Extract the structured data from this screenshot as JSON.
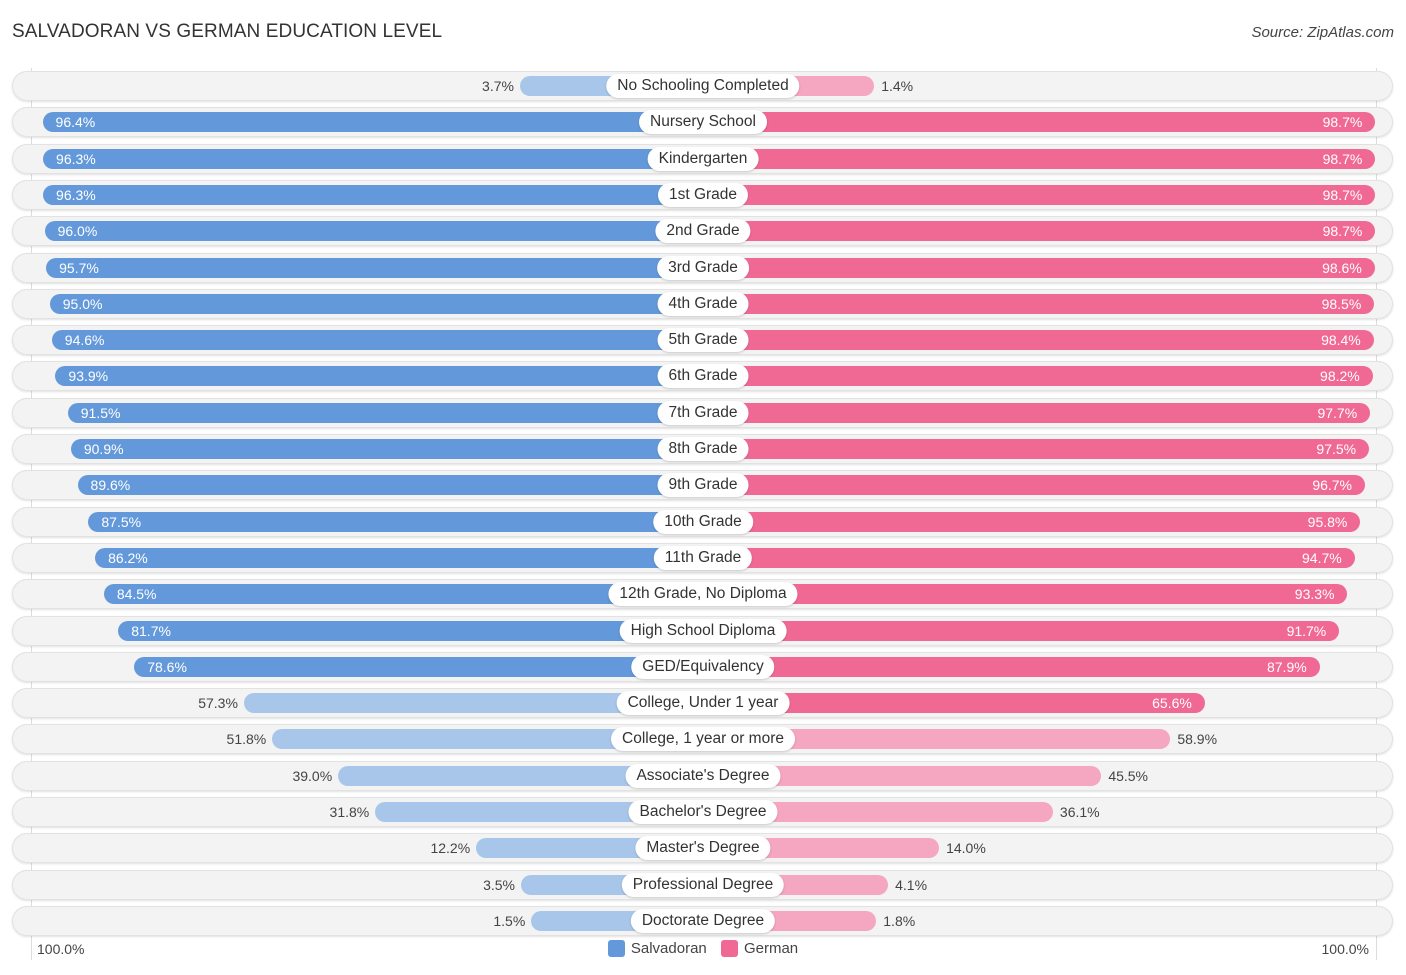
{
  "chart_data": {
    "type": "bar",
    "orientation": "horizontal-diverging",
    "title": "SALVADORAN VS GERMAN EDUCATION LEVEL",
    "source": "Source: ZipAtlas.com",
    "xlabel": "",
    "ylabel": "",
    "axis_left_label": "100.0%",
    "axis_right_label": "100.0%",
    "xlim": [
      0,
      100
    ],
    "legend_position": "bottom-center",
    "categories": [
      "No Schooling Completed",
      "Nursery School",
      "Kindergarten",
      "1st Grade",
      "2nd Grade",
      "3rd Grade",
      "4th Grade",
      "5th Grade",
      "6th Grade",
      "7th Grade",
      "8th Grade",
      "9th Grade",
      "10th Grade",
      "11th Grade",
      "12th Grade, No Diploma",
      "High School Diploma",
      "GED/Equivalency",
      "College, Under 1 year",
      "College, 1 year or more",
      "Associate's Degree",
      "Bachelor's Degree",
      "Master's Degree",
      "Professional Degree",
      "Doctorate Degree"
    ],
    "series": [
      {
        "name": "Salvadoran",
        "color": "#6399da",
        "light_color": "#a8c6ea",
        "values": [
          3.7,
          96.4,
          96.3,
          96.3,
          96.0,
          95.7,
          95.0,
          94.6,
          93.9,
          91.5,
          90.9,
          89.6,
          87.5,
          86.2,
          84.5,
          81.7,
          78.6,
          57.3,
          51.8,
          39.0,
          31.8,
          12.2,
          3.5,
          1.5
        ]
      },
      {
        "name": "German",
        "color": "#f06995",
        "light_color": "#f5a6c0",
        "values": [
          1.4,
          98.7,
          98.7,
          98.7,
          98.7,
          98.6,
          98.5,
          98.4,
          98.2,
          97.7,
          97.5,
          96.7,
          95.8,
          94.7,
          93.3,
          91.7,
          87.9,
          65.6,
          58.9,
          45.5,
          36.1,
          14.0,
          4.1,
          1.8
        ]
      }
    ],
    "value_labels": {
      "Salvadoran": [
        "3.7%",
        "96.4%",
        "96.3%",
        "96.3%",
        "96.0%",
        "95.7%",
        "95.0%",
        "94.6%",
        "93.9%",
        "91.5%",
        "90.9%",
        "89.6%",
        "87.5%",
        "86.2%",
        "84.5%",
        "81.7%",
        "78.6%",
        "57.3%",
        "51.8%",
        "39.0%",
        "31.8%",
        "12.2%",
        "3.5%",
        "1.5%"
      ],
      "German": [
        "1.4%",
        "98.7%",
        "98.7%",
        "98.7%",
        "98.7%",
        "98.6%",
        "98.5%",
        "98.4%",
        "98.2%",
        "97.7%",
        "97.5%",
        "96.7%",
        "95.8%",
        "94.7%",
        "93.3%",
        "91.7%",
        "87.9%",
        "65.6%",
        "58.9%",
        "45.5%",
        "36.1%",
        "14.0%",
        "4.1%",
        "1.8%"
      ]
    }
  }
}
